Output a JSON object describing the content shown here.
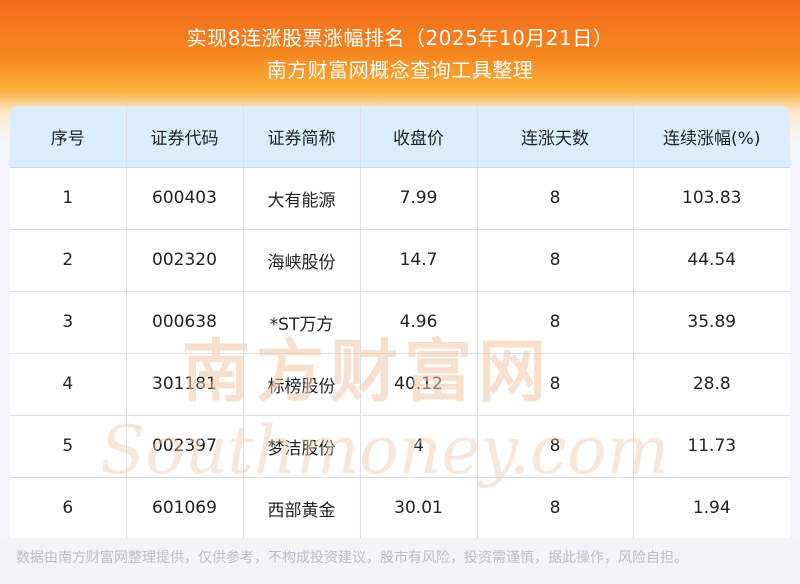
{
  "header": {
    "title": "实现8连涨股票涨幅排名（2025年10月21日）",
    "subtitle": "南方财富网概念查询工具整理"
  },
  "table": {
    "columns": [
      "序号",
      "证券代码",
      "证券简称",
      "收盘价",
      "连涨天数",
      "连续涨幅(%)"
    ],
    "rows": [
      [
        "1",
        "600403",
        "大有能源",
        "7.99",
        "8",
        "103.83"
      ],
      [
        "2",
        "002320",
        "海峡股份",
        "14.7",
        "8",
        "44.54"
      ],
      [
        "3",
        "000638",
        "*ST万方",
        "4.96",
        "8",
        "35.89"
      ],
      [
        "4",
        "301181",
        "标榜股份",
        "40.12",
        "8",
        "28.8"
      ],
      [
        "5",
        "002397",
        "梦洁股份",
        "4",
        "8",
        "11.73"
      ],
      [
        "6",
        "601069",
        "西部黄金",
        "30.01",
        "8",
        "1.94"
      ]
    ]
  },
  "watermark": {
    "cn": "南方财富网",
    "en": "Southmoney.com",
    "color": "#f3c7a6"
  },
  "footer": {
    "disclaimer": "数据由南方财富网整理提供，仅供参考，不构成投资建议，股市有风险，投资需谨慎，据此操作，风险自担。"
  }
}
